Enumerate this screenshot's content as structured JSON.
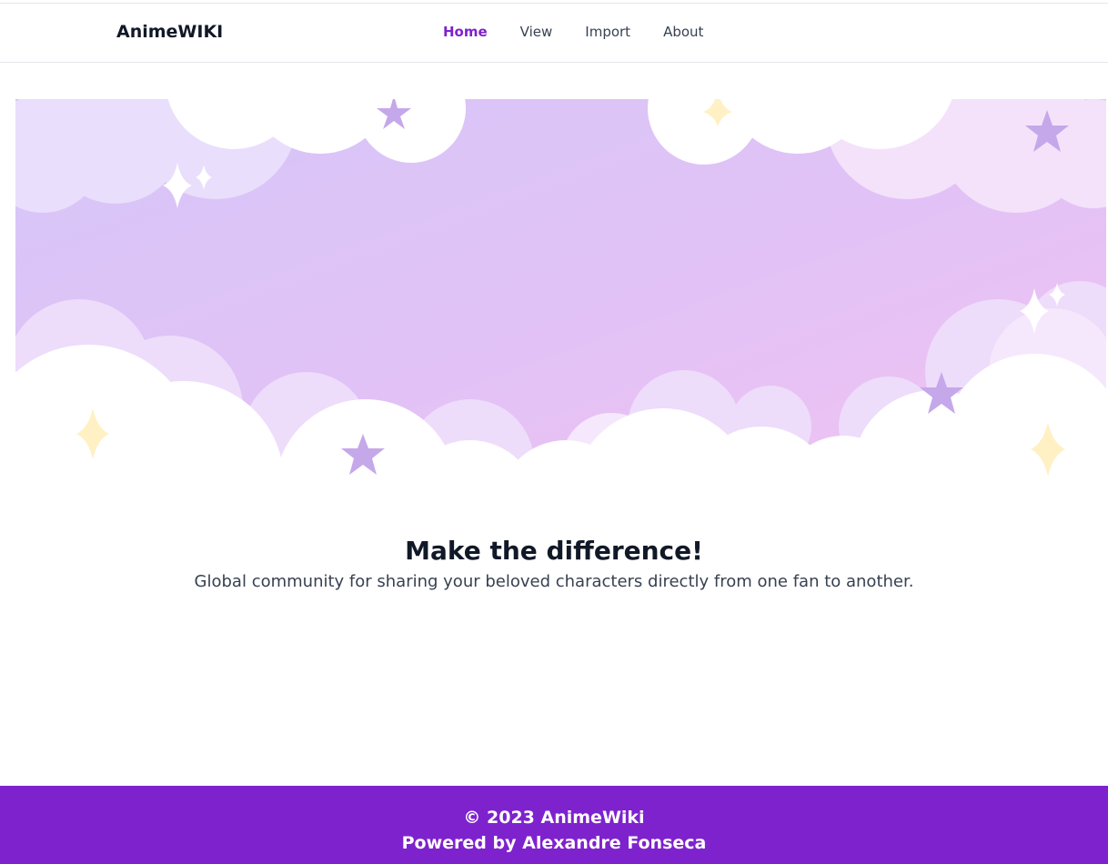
{
  "header": {
    "brand": "AnimeWIKI",
    "nav": [
      {
        "label": "Home",
        "active": true
      },
      {
        "label": "View",
        "active": false
      },
      {
        "label": "Import",
        "active": false
      },
      {
        "label": "About",
        "active": false
      }
    ]
  },
  "hero": {
    "illustration": "pastel-sky-clouds-stars",
    "headline": "Make the difference!",
    "subtitle": "Global community for sharing your beloved characters directly from one fan to another."
  },
  "footer": {
    "copyright": "© 2023 AnimeWiki",
    "credit": "Powered by Alexandre Fonseca"
  },
  "colors": {
    "accent": "#7e22ce",
    "sky_start": "#d8c8f8",
    "sky_end": "#f0c4f2",
    "star": "#c5a8ea",
    "sparkle_yellow": "#fff1c4"
  }
}
